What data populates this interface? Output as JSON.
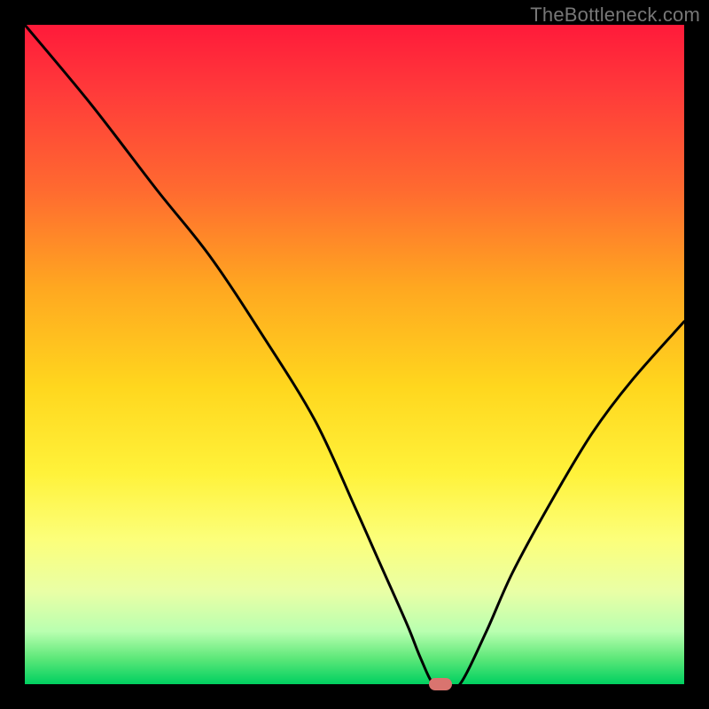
{
  "watermark": "TheBottleneck.com",
  "colors": {
    "frame": "#000000",
    "curve": "#000000",
    "marker": "#d9746f"
  },
  "chart_data": {
    "type": "line",
    "title": "",
    "xlabel": "",
    "ylabel": "",
    "xlim": [
      0,
      100
    ],
    "ylim": [
      0,
      100
    ],
    "grid": false,
    "x": [
      0,
      10,
      20,
      28,
      36,
      44,
      50,
      54,
      58,
      60,
      62,
      64,
      66,
      70,
      74,
      80,
      86,
      92,
      100
    ],
    "values": [
      100,
      88,
      75,
      65,
      53,
      40,
      27,
      18,
      9,
      4,
      0,
      0,
      0,
      8,
      17,
      28,
      38,
      46,
      55
    ],
    "marker": {
      "x": 63,
      "y": 0
    },
    "note": "x and values are normalized 0–100; rendered into the 744×744 plot area"
  }
}
